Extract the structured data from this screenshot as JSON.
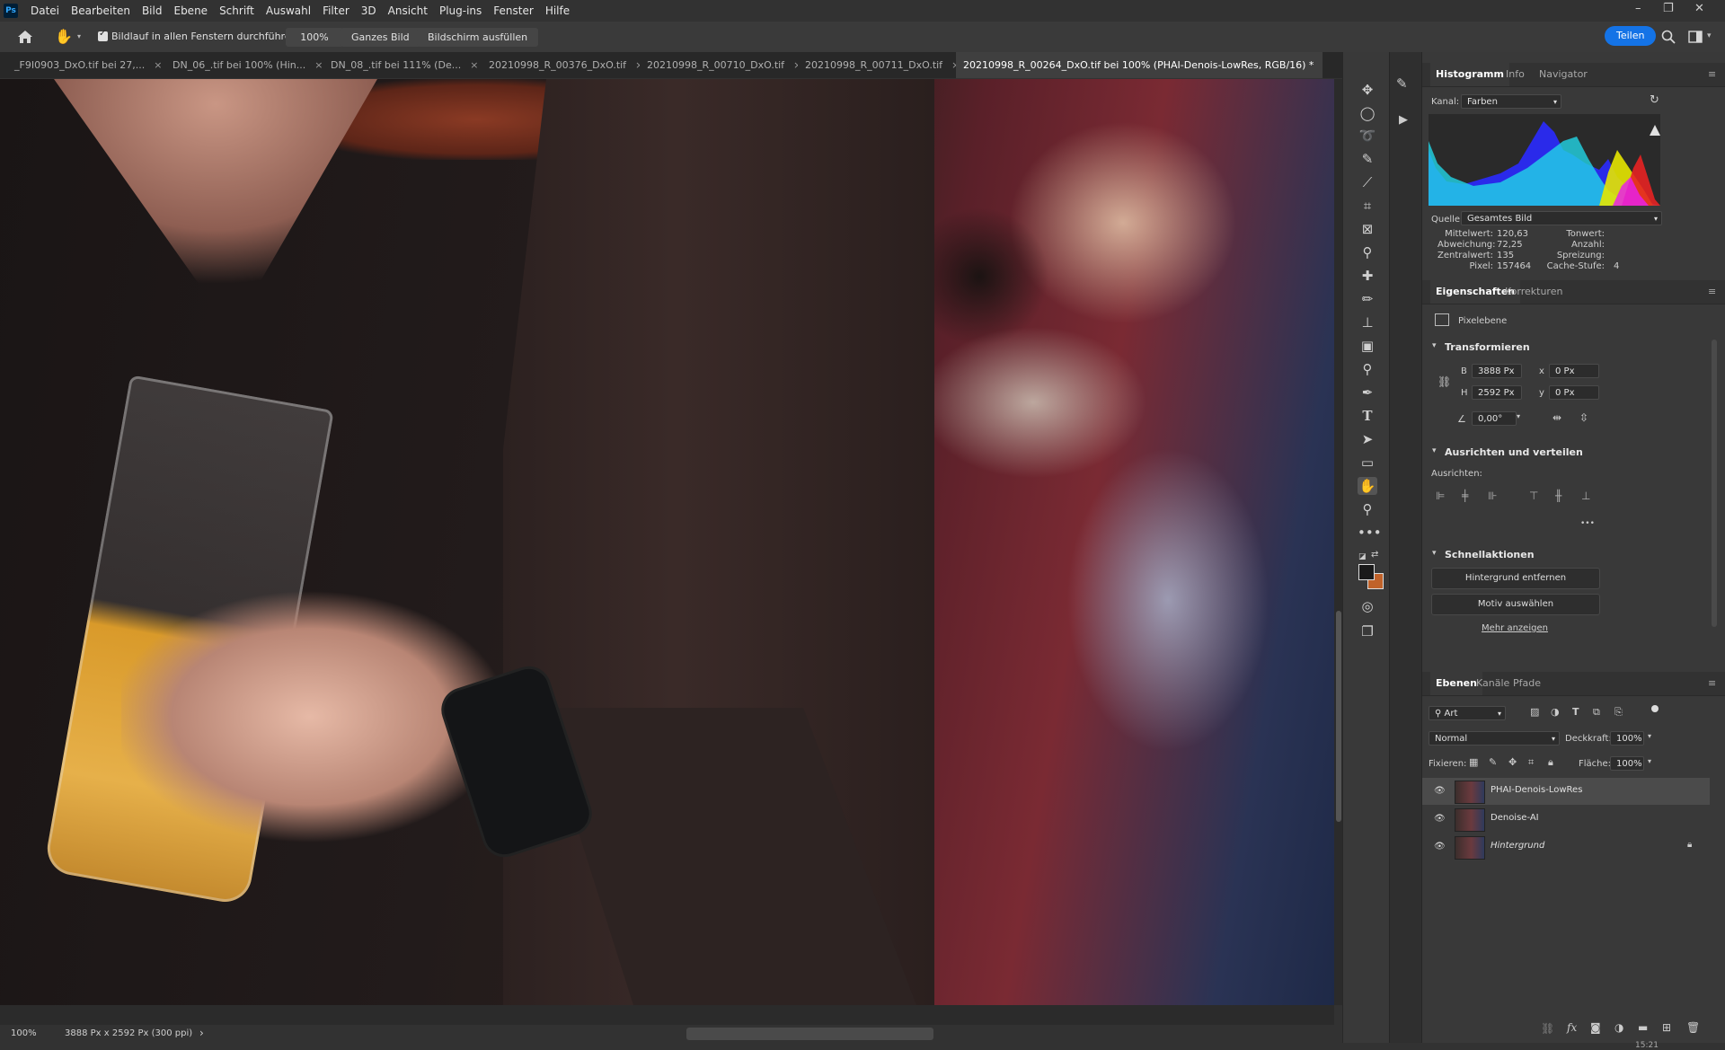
{
  "app": {
    "logo_text": "Ps"
  },
  "menu": [
    "Datei",
    "Bearbeiten",
    "Bild",
    "Ebene",
    "Schrift",
    "Auswahl",
    "Filter",
    "3D",
    "Ansicht",
    "Plug-ins",
    "Fenster",
    "Hilfe"
  ],
  "window_controls": {
    "minimize": "–",
    "restore": "❐",
    "close": "✕"
  },
  "options": {
    "scroll_all_label": "Bildlauf in allen Fenstern durchführen",
    "zoom_value": "100%",
    "fit_screen": "Ganzes Bild",
    "fill_screen": "Bildschirm ausfüllen",
    "share": "Teilen"
  },
  "tabs": [
    {
      "label": "_F9I0903_DxO.tif bei 27,...",
      "active": false
    },
    {
      "label": "DN_06_.tif bei 100% (Hin...",
      "active": false
    },
    {
      "label": "DN_08_.tif bei 111% (De...",
      "active": false
    },
    {
      "label": "20210998_R_00376_DxO.tif",
      "active": false
    },
    {
      "label": "20210998_R_00710_DxO.tif",
      "active": false
    },
    {
      "label": "20210998_R_00711_DxO.tif",
      "active": false
    },
    {
      "label": "20210998_R_00264_DxO.tif bei 100% (PHAI-Denois-LowRes, RGB/16) *",
      "active": true
    }
  ],
  "tab_close": "×",
  "status": {
    "zoom": "100%",
    "doc_size": "3888 Px x 2592 Px (300 ppi)",
    "arrow": "›",
    "clock": "15:21"
  },
  "histogram": {
    "tabs": [
      "Histogramm",
      "Info",
      "Navigator"
    ],
    "channel_label": "Kanal:",
    "channel_value": "Farben",
    "source_label": "Quelle:",
    "source_value": "Gesamtes Bild",
    "stats": [
      {
        "label": "Mittelwert:",
        "value": "120,63"
      },
      {
        "label": "Abweichung:",
        "value": "72,25"
      },
      {
        "label": "Zentralwert:",
        "value": "135"
      },
      {
        "label": "Pixel:",
        "value": "157464"
      }
    ],
    "stats_right": [
      {
        "label": "Tonwert:",
        "value": ""
      },
      {
        "label": "Anzahl:",
        "value": ""
      },
      {
        "label": "Spreizung:",
        "value": ""
      },
      {
        "label": "Cache-Stufe:",
        "value": "4"
      }
    ]
  },
  "properties": {
    "tabs": [
      "Eigenschaften",
      "Korrekturen"
    ],
    "layer_type": "Pixelebene",
    "transform_title": "Transformieren",
    "b_label": "B",
    "b_value": "3888 Px",
    "h_label": "H",
    "h_value": "2592 Px",
    "x_label": "x",
    "x_value": "0 Px",
    "y_label": "y",
    "y_value": "0 Px",
    "angle_value": "0,00°",
    "align_title": "Ausrichten und verteilen",
    "align_label": "Ausrichten:",
    "more_dots": "•••",
    "quick_title": "Schnellaktionen",
    "remove_bg": "Hintergrund entfernen",
    "select_subject": "Motiv auswählen",
    "show_more": "Mehr anzeigen"
  },
  "layers": {
    "tabs": [
      "Ebenen",
      "Kanäle",
      "Pfade"
    ],
    "filter_value": "Art",
    "blend_mode": "Normal",
    "opacity_label": "Deckkraft:",
    "opacity_value": "100%",
    "lock_label": "Fixieren:",
    "fill_label": "Fläche:",
    "fill_value": "100%",
    "items": [
      {
        "name": "PHAI-Denois-LowRes",
        "selected": true,
        "locked": false
      },
      {
        "name": "Denoise-AI",
        "selected": false,
        "locked": false
      },
      {
        "name": "Hintergrund",
        "selected": false,
        "locked": true
      }
    ]
  },
  "colors": {
    "foreground": "#1a1a1a",
    "background": "#c0622a",
    "accent": "#1473e6"
  }
}
